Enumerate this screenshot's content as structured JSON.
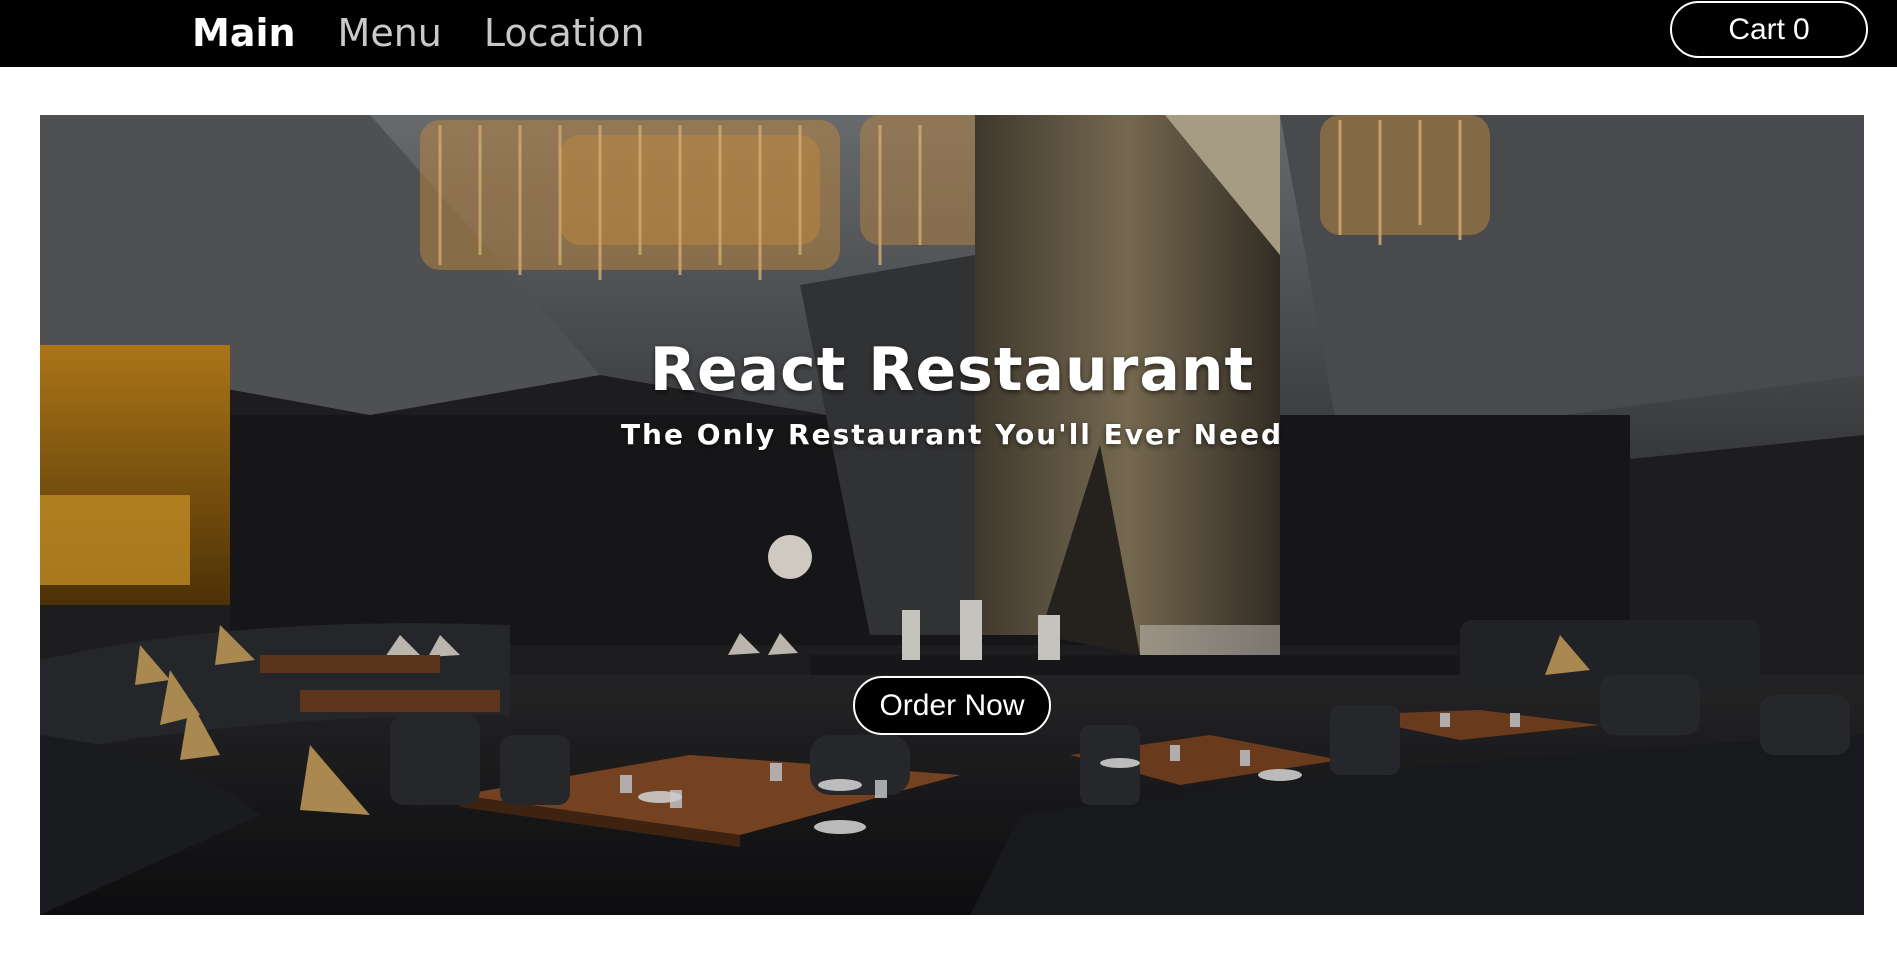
{
  "nav": {
    "links": [
      {
        "label": "Main",
        "active": true
      },
      {
        "label": "Menu",
        "active": false
      },
      {
        "label": "Location",
        "active": false
      }
    ],
    "cart": {
      "label": "Cart",
      "count": "0"
    }
  },
  "hero": {
    "title": "React Restaurant",
    "subtitle": "The Only Restaurant You'll Ever Need",
    "order_label": "Order Now",
    "image": "restaurant-interior-photo"
  },
  "colors": {
    "navbar_bg": "#000000",
    "nav_active": "#ffffff",
    "nav_inactive": "#c9c9c9",
    "button_bg": "#000000",
    "button_border": "#ffffff",
    "page_bg": "#ffffff"
  }
}
